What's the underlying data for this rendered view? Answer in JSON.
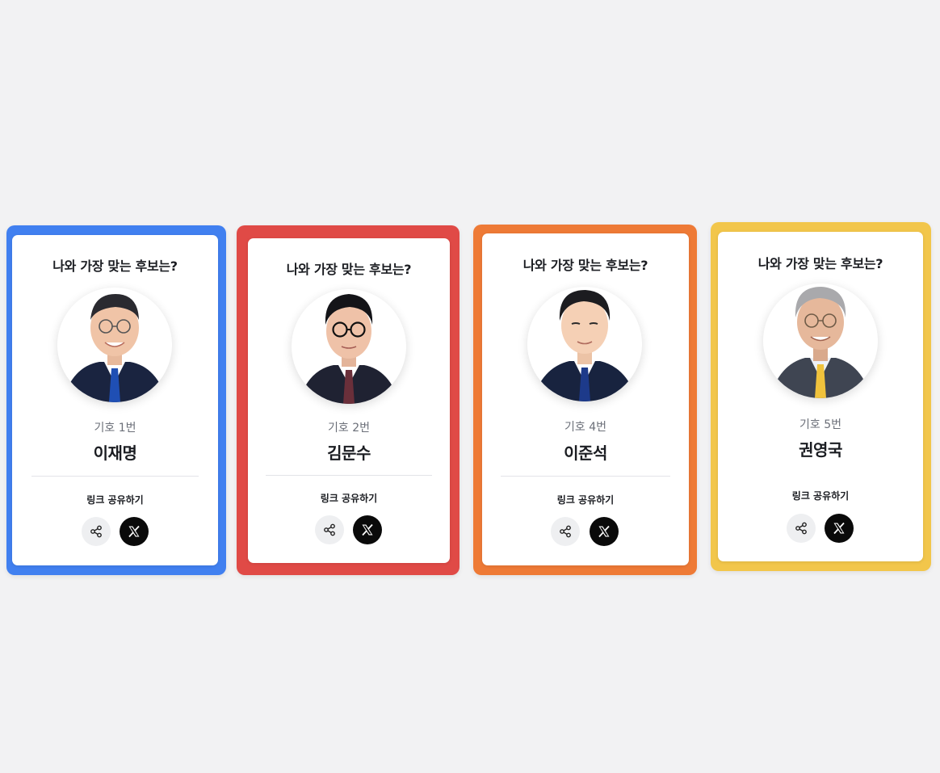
{
  "colors": {
    "blue": "#4180f0",
    "red": "#e04a46",
    "orange": "#ee7a36",
    "yellow": "#f2c64b",
    "background": "#f2f2f3"
  },
  "cards": [
    {
      "question": "나와 가장 맞는 후보는?",
      "number_label": "기호 1번",
      "name": "이재명",
      "share_label": "링크 공유하기",
      "share_icon": "share-icon",
      "x_icon": "x-logo-icon",
      "frame_color": "blue",
      "tie_color": "#1f4fb4"
    },
    {
      "question": "나와 가장 맞는 후보는?",
      "number_label": "기호 2번",
      "name": "김문수",
      "share_label": "링크 공유하기",
      "share_icon": "share-icon",
      "x_icon": "x-logo-icon",
      "frame_color": "red",
      "tie_color": "#6a2f3a"
    },
    {
      "question": "나와 가장 맞는 후보는?",
      "number_label": "기호 4번",
      "name": "이준석",
      "share_label": "링크 공유하기",
      "share_icon": "share-icon",
      "x_icon": "x-logo-icon",
      "frame_color": "orange",
      "tie_color": "#1d3a8a"
    },
    {
      "question": "나와 가장 맞는 후보는?",
      "number_label": "기호 5번",
      "name": "권영국",
      "share_label": "링크 공유하기",
      "share_icon": "share-icon",
      "x_icon": "x-logo-icon",
      "frame_color": "yellow",
      "tie_color": "#f0c23c"
    }
  ]
}
